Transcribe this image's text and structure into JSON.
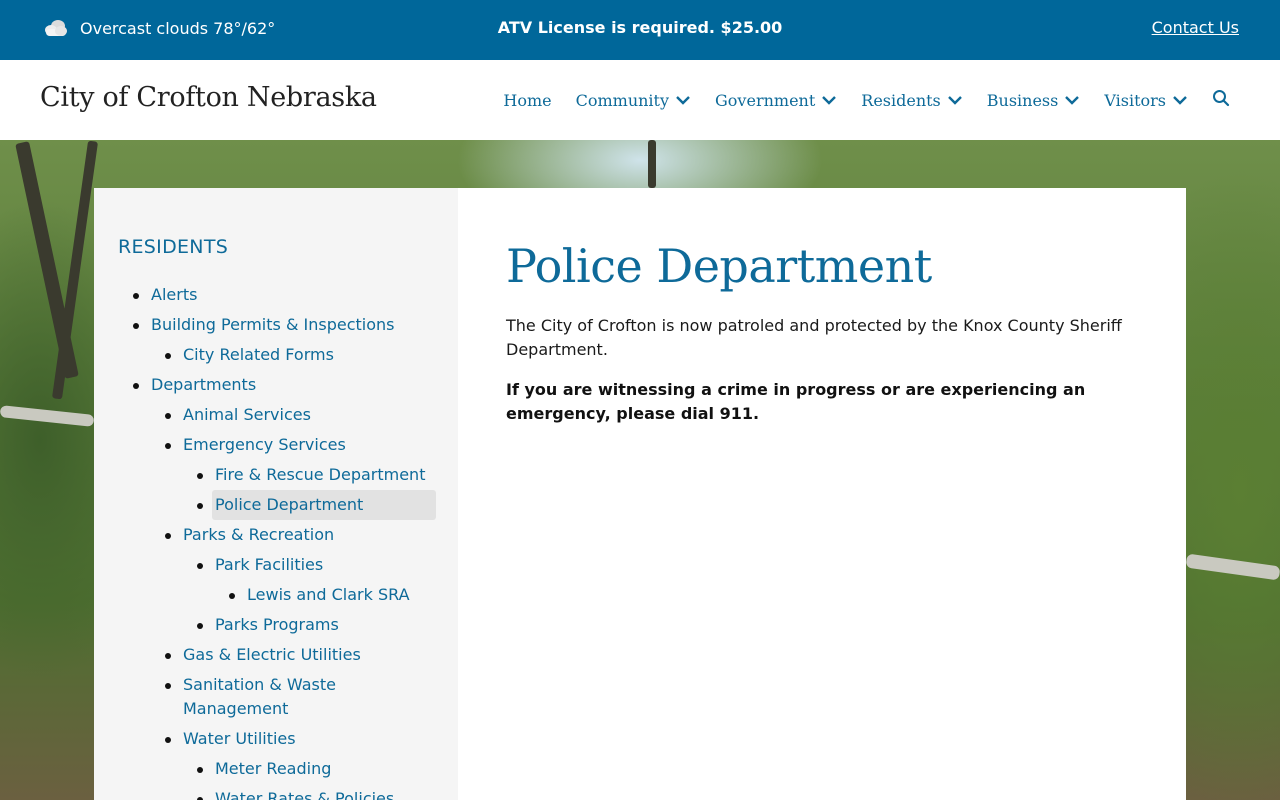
{
  "topbar": {
    "weather_text": "Overcast clouds 78°/62°",
    "alert": "ATV License is required. $25.00",
    "contact_label": "Contact Us",
    "icon": "cloud-icon"
  },
  "header": {
    "site_title": "City of Crofton Nebraska",
    "nav": [
      {
        "label": "Home",
        "dropdown": false
      },
      {
        "label": "Community",
        "dropdown": true
      },
      {
        "label": "Government",
        "dropdown": true
      },
      {
        "label": "Residents",
        "dropdown": true
      },
      {
        "label": "Business",
        "dropdown": true
      },
      {
        "label": "Visitors",
        "dropdown": true
      }
    ],
    "search_icon": "search-icon"
  },
  "sidebar": {
    "heading": "RESIDENTS",
    "items": [
      {
        "label": "Alerts",
        "level": 1
      },
      {
        "label": "Building Permits & Inspections",
        "level": 1
      },
      {
        "label": "City Related Forms",
        "level": 2
      },
      {
        "label": "Departments",
        "level": 1
      },
      {
        "label": "Animal Services",
        "level": 2
      },
      {
        "label": "Emergency Services",
        "level": 2
      },
      {
        "label": "Fire & Rescue Department",
        "level": 3
      },
      {
        "label": "Police Department",
        "level": 3,
        "active": true
      },
      {
        "label": "Parks & Recreation",
        "level": 2
      },
      {
        "label": "Park Facilities",
        "level": 3
      },
      {
        "label": "Lewis and Clark SRA",
        "level": 4
      },
      {
        "label": "Parks Programs",
        "level": 3
      },
      {
        "label": "Gas & Electric Utilities",
        "level": 2
      },
      {
        "label": "Sanitation & Waste Management",
        "level": 2
      },
      {
        "label": "Water Utilities",
        "level": 2
      },
      {
        "label": "Meter Reading",
        "level": 3
      },
      {
        "label": "Water Rates & Policies",
        "level": 3
      }
    ]
  },
  "main": {
    "title": "Police Department",
    "paragraph1": "The City of Crofton is now patroled and protected by the Knox County Sheriff Department.",
    "paragraph2": "If you are witnessing a crime in progress or are experiencing an emergency, please dial 911."
  },
  "colors": {
    "brand_blue": "#00679a",
    "link_blue": "#0e6a99",
    "sidebar_bg": "#f5f5f5",
    "active_bg": "#e2e2e2"
  }
}
